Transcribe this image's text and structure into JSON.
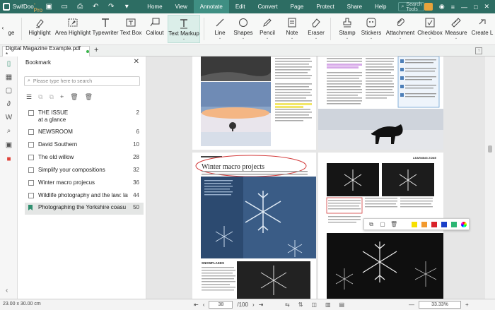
{
  "app": {
    "name": "SwifDoo",
    "suffix": "-Pro"
  },
  "quick_access": [
    "save-icon",
    "folder-icon",
    "print-icon",
    "undo-icon",
    "redo-icon",
    "dropdown-icon"
  ],
  "menus": [
    "Home",
    "View",
    "Annotate",
    "Edit",
    "Convert",
    "Page",
    "Protect",
    "Share",
    "Help"
  ],
  "active_menu": "Annotate",
  "search": {
    "placeholder": "Search Tools"
  },
  "ribbon": {
    "scroll_left_label": "‹",
    "partial_left": "ge",
    "items": [
      {
        "label": "Highlight",
        "icon": "highlighter-icon",
        "dropdown": true
      },
      {
        "label": "Area Highlight",
        "icon": "area-highlight-icon",
        "dropdown": false
      },
      {
        "label": "Typewriter",
        "icon": "typewriter-icon",
        "dropdown": false
      },
      {
        "label": "Text Box",
        "icon": "textbox-icon",
        "dropdown": false
      },
      {
        "label": "Callout",
        "icon": "callout-icon",
        "dropdown": false
      },
      {
        "label": "Text Markup",
        "icon": "text-markup-icon",
        "dropdown": true
      },
      {
        "label": "Line",
        "icon": "line-icon",
        "dropdown": true
      },
      {
        "label": "Shapes",
        "icon": "shapes-icon",
        "dropdown": true
      },
      {
        "label": "Pencil",
        "icon": "pencil-icon",
        "dropdown": true
      },
      {
        "label": "Note",
        "icon": "note-icon",
        "dropdown": true
      },
      {
        "label": "Eraser",
        "icon": "eraser-icon",
        "dropdown": true
      },
      {
        "label": "Stamp",
        "icon": "stamp-icon",
        "dropdown": true
      },
      {
        "label": "Stickers",
        "icon": "stickers-icon",
        "dropdown": true
      },
      {
        "label": "Attachment",
        "icon": "attachment-icon",
        "dropdown": true
      },
      {
        "label": "Checkbox",
        "icon": "checkbox-icon",
        "dropdown": true
      },
      {
        "label": "Measure",
        "icon": "measure-icon",
        "dropdown": true
      },
      {
        "label": "Create L",
        "icon": "create-link-icon",
        "dropdown": false
      }
    ],
    "active": "Text Markup"
  },
  "document_tab": {
    "name": "Digital Magazine Example.pdf *",
    "new_tab": "+"
  },
  "left_icons": [
    "bookmark-icon",
    "page-thumbnail-icon",
    "comment-icon",
    "attachment-icon",
    "word-icon",
    "search-icon",
    "image-icon",
    "gift-icon"
  ],
  "bookmark_panel": {
    "title": "Bookmark",
    "search_placeholder": "Please type here to search",
    "items": [
      {
        "title": "THE ISSUE",
        "subtitle": "at a glance",
        "page": "2"
      },
      {
        "title": "NEWSROOM",
        "page": "6"
      },
      {
        "title": "David Southern",
        "page": "10"
      },
      {
        "title": "The old willow",
        "page": "28"
      },
      {
        "title": "Simplify your compositions",
        "page": "32"
      },
      {
        "title": "Winter macro projecus",
        "page": "36"
      },
      {
        "title": "Wildlife photography and the law: land",
        "page": "44"
      },
      {
        "title": "Photographing the Yorkshire coasu",
        "page": "50"
      }
    ],
    "selected_index": 7
  },
  "document": {
    "heading": "Winter macro projects",
    "learning_zone": "LEARNING ZONE",
    "snowflakes": "SNOWFLAKES"
  },
  "mini_toolbar": {
    "colors": [
      "#f7e000",
      "#f29a2e",
      "#d9222a",
      "#1a3fc8",
      "#2bb673",
      "rainbow"
    ]
  },
  "status": {
    "page_size": "23.00 x 30.00 cm",
    "current_page": "38",
    "total_pages": "/100",
    "zoom": "33.33%"
  },
  "colors": {
    "titlebar": "#2d6d63",
    "active_menu": "#3f8f83",
    "accent": "#2f8f6f"
  }
}
